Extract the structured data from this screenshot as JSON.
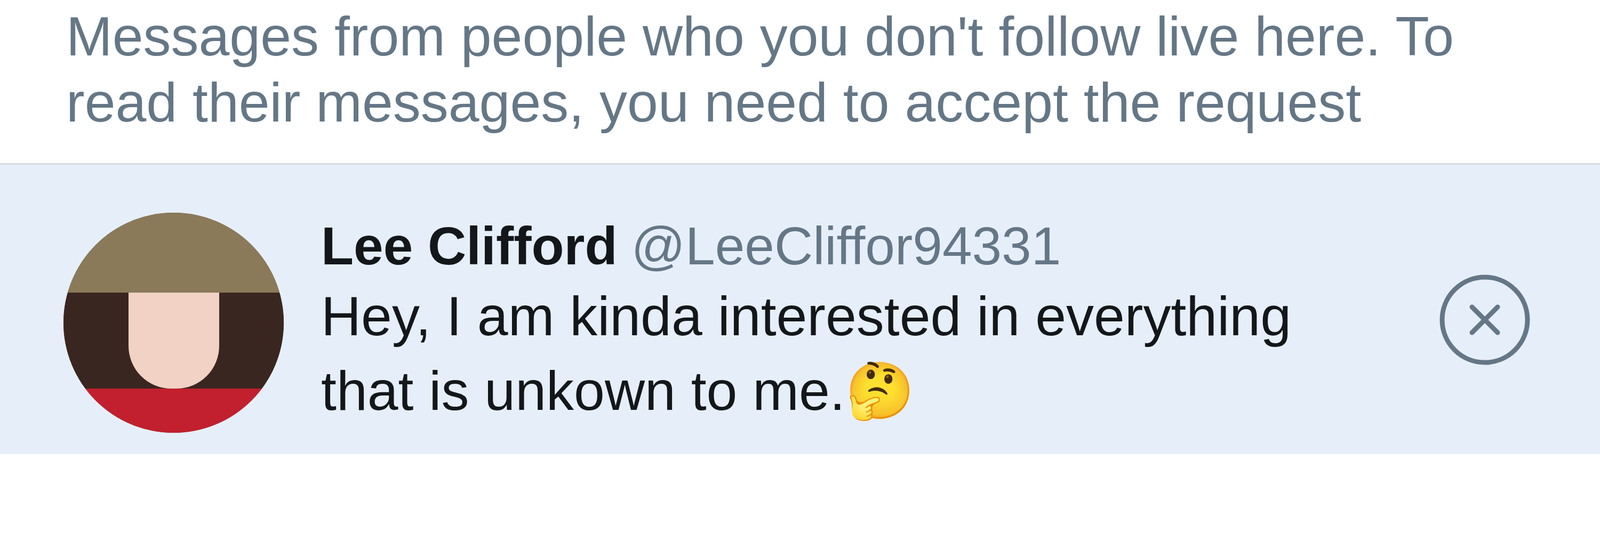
{
  "info": {
    "text": "Messages from people who you don't follow live here. To read their messages, you need to accept the request"
  },
  "requests": [
    {
      "name": "Lee Clifford",
      "handle": "@LeeCliffor94331",
      "message": "Hey, I am kinda interested in everything that is unkown to me.🤔",
      "selected": true
    }
  ]
}
